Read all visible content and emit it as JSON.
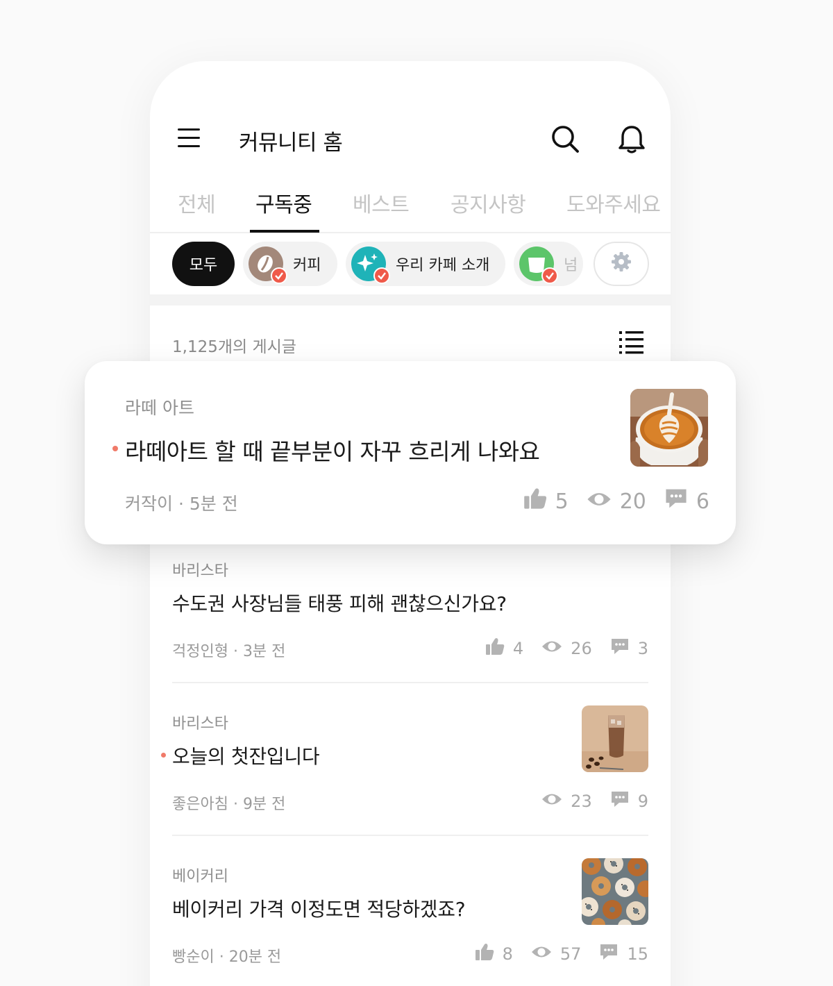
{
  "header": {
    "title": "커뮤니티 홈"
  },
  "tabs": [
    {
      "label": "전체"
    },
    {
      "label": "구독중"
    },
    {
      "label": "베스트"
    },
    {
      "label": "공지사항"
    },
    {
      "label": "도와주세요"
    }
  ],
  "active_tab": "구독중",
  "chips": [
    {
      "label": "모두"
    },
    {
      "label": "커피"
    },
    {
      "label": "우리 카페 소개"
    },
    {
      "label": "넘"
    }
  ],
  "feed": {
    "post_count": "1,125개의 게시글"
  },
  "featured_post": {
    "category": "라떼 아트",
    "title": "라떼아트 할 때 끝부분이 자꾸 흐리게 나와요",
    "meta": "커작이 · 5분 전",
    "likes": "5",
    "views": "20",
    "comments": "6"
  },
  "posts": [
    {
      "category": "바리스타",
      "title": "수도권 사장님들 태풍 피해 괜찮으신가요?",
      "meta": "걱정인형 · 3분 전",
      "likes": "4",
      "views": "26",
      "comments": "3"
    },
    {
      "category": "바리스타",
      "title": "오늘의 첫잔입니다",
      "meta": "좋은아침 · 9분 전",
      "views": "23",
      "comments": "9"
    },
    {
      "category": "베이커리",
      "title": "베이커리 가격 이정도면 적당하겠죠?",
      "meta": "빵순이 · 20분 전",
      "likes": "8",
      "views": "57",
      "comments": "15"
    }
  ],
  "colors": {
    "accent_dot": "#f07a69",
    "badge_red": "#ef5a4a",
    "chip_active": "#111111",
    "text_muted": "#9a9a9a"
  },
  "icons": [
    "menu-icon",
    "search-icon",
    "bell-icon",
    "settings-gear-icon",
    "list-view-icon",
    "thumbs-up-icon",
    "eye-icon",
    "comment-icon",
    "check-icon"
  ]
}
